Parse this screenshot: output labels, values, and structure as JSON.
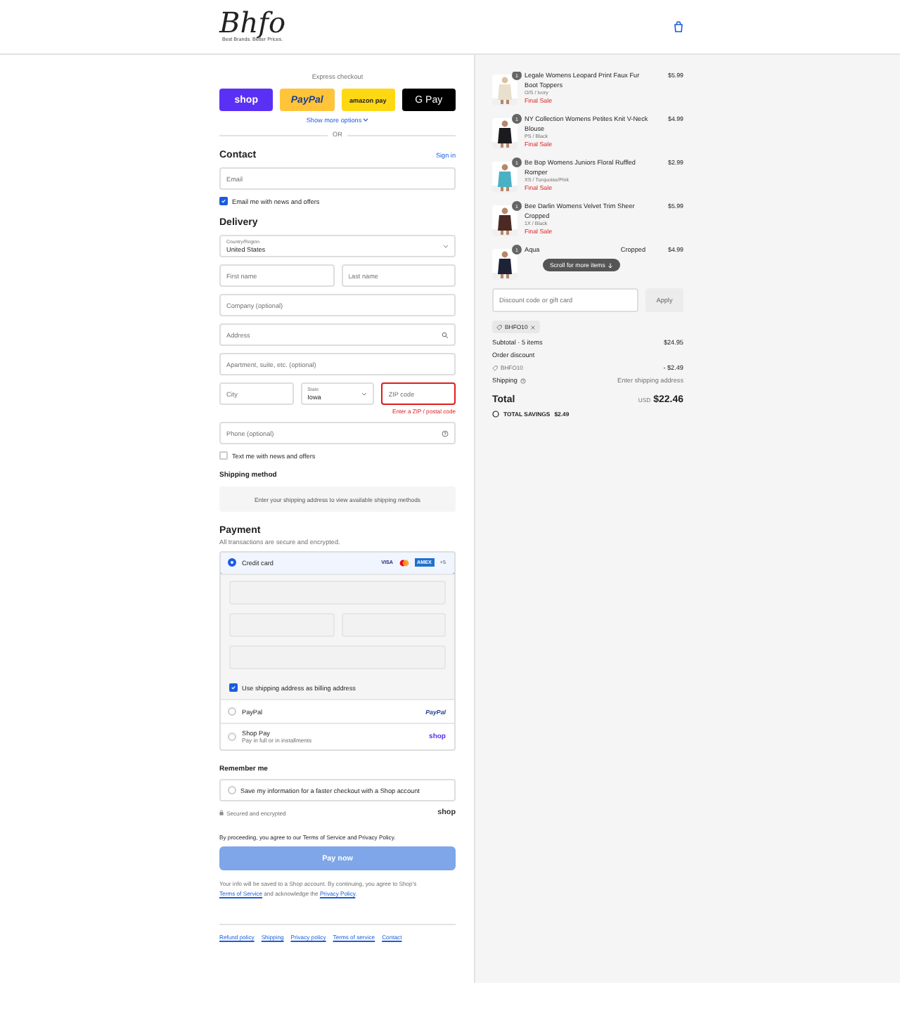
{
  "logo": {
    "text": "Bhfo",
    "tagline": "Best Brands. Better Prices."
  },
  "express": {
    "title": "Express checkout",
    "buttons": [
      {
        "kind": "shop",
        "label": "shop"
      },
      {
        "kind": "paypal",
        "label": "PayPal"
      },
      {
        "kind": "amazon",
        "label": "amazon pay"
      },
      {
        "kind": "gpay",
        "label": "G Pay"
      }
    ],
    "more": "Show more options",
    "or": "OR"
  },
  "contact": {
    "title": "Contact",
    "sign_in": "Sign in",
    "email": {
      "placeholder": "Email"
    },
    "news": {
      "label": "Email me with news and offers",
      "checked": true
    }
  },
  "delivery": {
    "title": "Delivery",
    "country": {
      "label": "Country/Region",
      "value": "United States"
    },
    "first_name": {
      "placeholder": "First name"
    },
    "last_name": {
      "placeholder": "Last name"
    },
    "company": {
      "placeholder": "Company (optional)"
    },
    "address": {
      "placeholder": "Address"
    },
    "apartment": {
      "placeholder": "Apartment, suite, etc. (optional)"
    },
    "city": {
      "placeholder": "City"
    },
    "state": {
      "label": "State",
      "value": "Iowa"
    },
    "zip": {
      "placeholder": "ZIP code",
      "error": "Enter a ZIP / postal code"
    },
    "phone": {
      "placeholder": "Phone (optional)"
    },
    "text_me": {
      "label": "Text me with news and offers",
      "checked": false
    }
  },
  "shipping": {
    "title": "Shipping method",
    "message": "Enter your shipping address to view available shipping methods"
  },
  "payment": {
    "title": "Payment",
    "subtitle": "All transactions are secure and encrypted.",
    "methods": [
      {
        "kind": "card",
        "label": "Credit card",
        "selected": true,
        "badges": [
          "VISA",
          "AMEX",
          "+5"
        ],
        "billing": {
          "label": "Use shipping address as billing address",
          "checked": true
        }
      },
      {
        "kind": "paypal",
        "label": "PayPal",
        "selected": false,
        "logo": "PayPal"
      },
      {
        "kind": "shoppay",
        "label": "Shop Pay",
        "sub": "Pay in full or in installments",
        "selected": false,
        "logo": "shop"
      }
    ]
  },
  "remember": {
    "title": "Remember me",
    "save": {
      "label": "Save my information for a faster checkout with a Shop account",
      "checked": false
    },
    "secure": "Secured and encrypted",
    "logo": "shop"
  },
  "terms": "By proceeding, you agree to our Terms of Service and Privacy Policy.",
  "pay_button": "Pay now",
  "info": {
    "parts": [
      "Your info will be saved to a Shop account. By continuing, you agree to Shop's ",
      "Terms of Service",
      " and acknowledge the ",
      "Privacy Policy",
      "."
    ]
  },
  "footer_links": [
    "Refund policy",
    "Shipping",
    "Privacy policy",
    "Terms of service",
    "Contact"
  ],
  "summary": {
    "items": [
      {
        "title": "Legale Womens Leopard Print Faux Fur Boot Toppers",
        "variant": "O/S / Ivory",
        "note": "Final Sale",
        "price": "$5.99",
        "quantity": "1"
      },
      {
        "title": "NY Collection Womens Petites Knit V-Neck Blouse",
        "variant": "PS / Black",
        "note": "Final Sale",
        "price": "$4.99",
        "quantity": "1"
      },
      {
        "title": "Be Bop Womens Juniors Floral Ruffled Romper",
        "variant": "XS / Turquoise/Pink",
        "note": "Final Sale",
        "price": "$2.99",
        "quantity": "1"
      },
      {
        "title": "Bee Darlin Womens Velvet Trim Sheer Cropped",
        "variant": "1X / Black",
        "note": "Final Sale",
        "price": "$5.99",
        "quantity": "1"
      },
      {
        "title": "Aqua",
        "title_end": "Cropped",
        "price": "$4.99",
        "quantity": "1"
      }
    ],
    "scroll_hint": "Scroll for more items",
    "discount": {
      "placeholder": "Discount code or gift card",
      "button": "Apply",
      "tag": "BHFO10"
    },
    "subtotal": {
      "label": "Subtotal · 5 items",
      "value": "$24.95"
    },
    "order_discount": {
      "label": "Order discount",
      "code": "BHFO10",
      "value": "- $2.49"
    },
    "shipping": {
      "label": "Shipping",
      "value": "Enter shipping address"
    },
    "total": {
      "label": "Total",
      "currency": "USD",
      "value": "$22.46"
    },
    "savings": {
      "label": "TOTAL SAVINGS",
      "value": "$2.49"
    }
  }
}
